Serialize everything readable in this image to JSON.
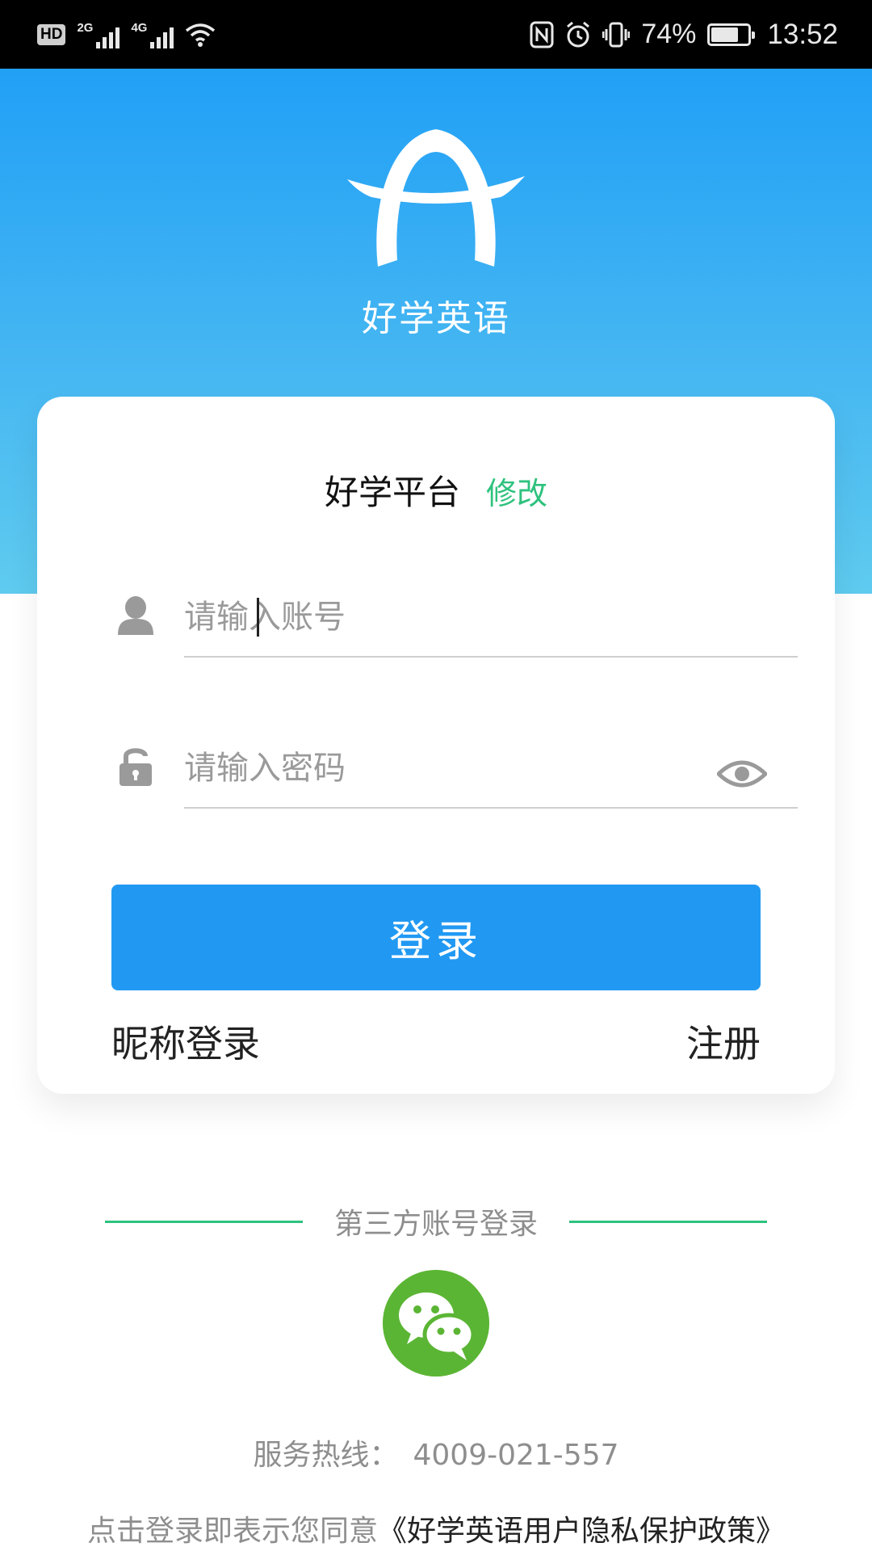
{
  "status_bar": {
    "hd": "HD",
    "net1": "2G",
    "net2": "4G",
    "battery_percent": "74%",
    "battery_level": 0.74,
    "time": "13:52"
  },
  "header": {
    "app_name": "好学英语"
  },
  "card": {
    "platform_name": "好学平台",
    "platform_edit": "修改",
    "account_placeholder": "请输入账号",
    "password_placeholder": "请输入密码",
    "login_label": "登录",
    "nickname_login_label": "昵称登录",
    "register_label": "注册"
  },
  "third_party": {
    "label": "第三方账号登录",
    "wechat_icon": "wechat-icon"
  },
  "footer": {
    "hotline_label": "服务热线：",
    "hotline_number": "4009-021-557",
    "agreement_prefix": "点击登录即表示您同意",
    "agreement_policy": "《好学英语用户隐私保护政策》"
  },
  "colors": {
    "primary_blue": "#2199f3",
    "accent_green": "#2ec27e",
    "wechat_green": "#5bb534"
  }
}
